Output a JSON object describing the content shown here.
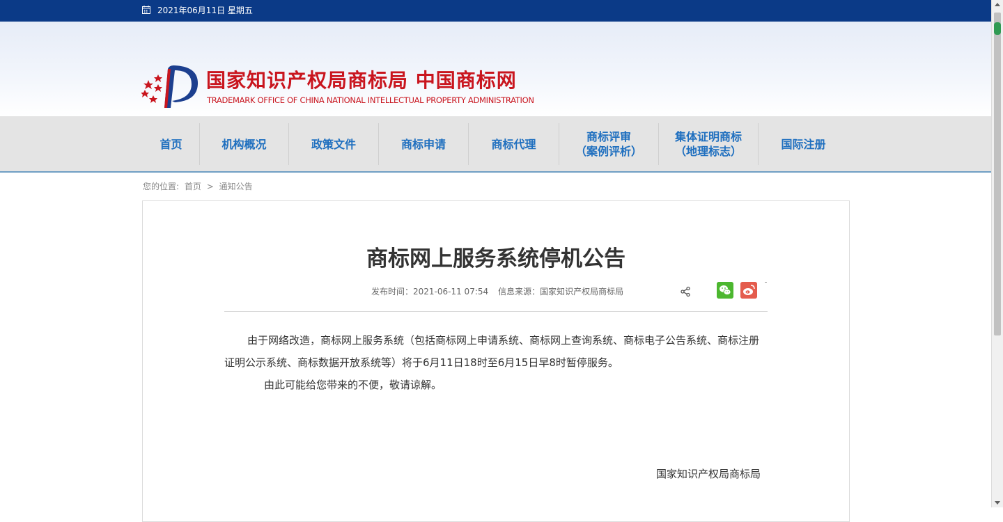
{
  "topbar": {
    "date": "2021年06月11日 星期五"
  },
  "header": {
    "logo_cn": "国家知识产权局商标局 中国商标网",
    "logo_en": "TRADEMARK OFFICE OF CHINA NATIONAL INTELLECTUAL PROPERTY ADMINISTRATION"
  },
  "nav": {
    "items": [
      {
        "line1": "首页",
        "line2": ""
      },
      {
        "line1": "机构概况",
        "line2": ""
      },
      {
        "line1": "政策文件",
        "line2": ""
      },
      {
        "line1": "商标申请",
        "line2": ""
      },
      {
        "line1": "商标代理",
        "line2": ""
      },
      {
        "line1": "商标评审",
        "line2": "（案例评析）"
      },
      {
        "line1": "集体证明商标",
        "line2": "（地理标志）"
      },
      {
        "line1": "国际注册",
        "line2": ""
      }
    ]
  },
  "breadcrumb": {
    "prefix": "您的位置:",
    "home": "首页",
    "sep": ">",
    "current": "通知公告"
  },
  "article": {
    "title": "商标网上服务系统停机公告",
    "publish_time": "发布时间：2021-06-11 07:54",
    "source": "信息来源：国家知识产权局商标局",
    "paragraph1": "由于网络改造，商标网上服务系统（包括商标网上申请系统、商标网上查询系统、商标电子公告系统、商标注册证明公示系统、商标数据开放系统等）将于6月11日18时至6月15日早8时暂停服务。",
    "paragraph2": "由此可能给您带来的不便，敬请谅解。",
    "signature": "国家知识产权局商标局"
  },
  "colors": {
    "topbar": "#0b3a87",
    "brand_red": "#c9151e",
    "nav_text": "#1f6fbf",
    "wechat": "#4cb72f",
    "weibo": "#e45c4d"
  },
  "icons": [
    "calendar-icon",
    "share-icon",
    "wechat-icon",
    "weibo-icon"
  ]
}
